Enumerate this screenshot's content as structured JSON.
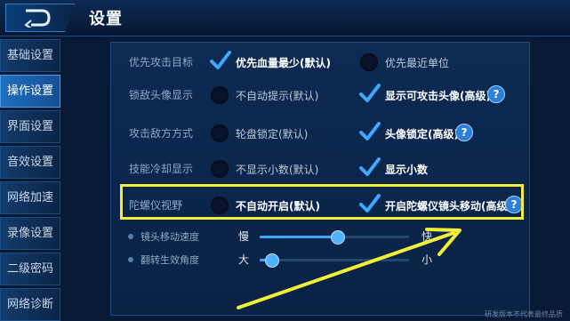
{
  "header": {
    "title": "设置"
  },
  "sidebar": {
    "items": [
      {
        "label": "基础设置",
        "active": false
      },
      {
        "label": "操作设置",
        "active": true
      },
      {
        "label": "界面设置",
        "active": false
      },
      {
        "label": "音效设置",
        "active": false
      },
      {
        "label": "网络加速",
        "active": false
      },
      {
        "label": "录像设置",
        "active": false
      },
      {
        "label": "二级密码",
        "active": false
      },
      {
        "label": "网络诊断",
        "active": false
      }
    ]
  },
  "settings": {
    "target_priority": {
      "label": "优先攻击目标",
      "option1": {
        "label": "优先血量最少(默认)",
        "selected": true
      },
      "option2": {
        "label": "优先最近单位",
        "selected": false
      }
    },
    "lock_avatar": {
      "label": "锁敌头像显示",
      "option1": {
        "label": "不自动提示(默认)",
        "selected": false
      },
      "option2": {
        "label": "显示可攻击头像(高级)",
        "selected": true
      }
    },
    "attack_mode": {
      "label": "攻击敌方方式",
      "option1": {
        "label": "轮盘锁定(默认)",
        "selected": false
      },
      "option2": {
        "label": "头像锁定(高级)",
        "selected": true
      }
    },
    "cooldown_display": {
      "label": "技能冷却显示",
      "option1": {
        "label": "不显示小数(默认)",
        "selected": false
      },
      "option2": {
        "label": "显示小数",
        "selected": true
      }
    },
    "gyroscope": {
      "label": "陀螺仪视野",
      "option1": {
        "label": "不自动开启(默认)",
        "selected": false
      },
      "option2": {
        "label": "开启陀螺仪镜头移动(高级)",
        "selected": true
      }
    },
    "camera_speed": {
      "label": "镜头移动速度",
      "min_label": "慢",
      "max_label": "快",
      "value": 0.52
    },
    "flip_angle": {
      "label": "翻转生效角度",
      "min_label": "大",
      "max_label": "小",
      "value": 0.08
    }
  },
  "help_symbol": "?",
  "watermark": "研发版本不代表最终品质",
  "colors": {
    "highlight": "#f2ef3a",
    "check": "#3fa6ff",
    "accent": "#2d7fd8"
  }
}
